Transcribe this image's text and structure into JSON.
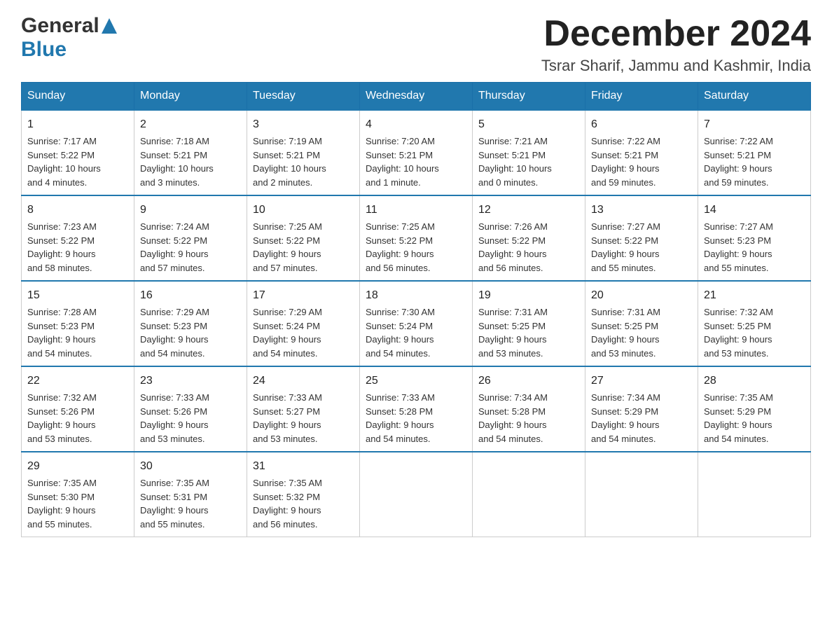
{
  "header": {
    "logo_general": "General",
    "logo_blue": "Blue",
    "month_title": "December 2024",
    "location": "Tsrar Sharif, Jammu and Kashmir, India"
  },
  "calendar": {
    "days_of_week": [
      "Sunday",
      "Monday",
      "Tuesday",
      "Wednesday",
      "Thursday",
      "Friday",
      "Saturday"
    ],
    "weeks": [
      [
        {
          "day": "1",
          "sunrise": "7:17 AM",
          "sunset": "5:22 PM",
          "daylight": "10 hours and 4 minutes."
        },
        {
          "day": "2",
          "sunrise": "7:18 AM",
          "sunset": "5:21 PM",
          "daylight": "10 hours and 3 minutes."
        },
        {
          "day": "3",
          "sunrise": "7:19 AM",
          "sunset": "5:21 PM",
          "daylight": "10 hours and 2 minutes."
        },
        {
          "day": "4",
          "sunrise": "7:20 AM",
          "sunset": "5:21 PM",
          "daylight": "10 hours and 1 minute."
        },
        {
          "day": "5",
          "sunrise": "7:21 AM",
          "sunset": "5:21 PM",
          "daylight": "10 hours and 0 minutes."
        },
        {
          "day": "6",
          "sunrise": "7:22 AM",
          "sunset": "5:21 PM",
          "daylight": "9 hours and 59 minutes."
        },
        {
          "day": "7",
          "sunrise": "7:22 AM",
          "sunset": "5:21 PM",
          "daylight": "9 hours and 59 minutes."
        }
      ],
      [
        {
          "day": "8",
          "sunrise": "7:23 AM",
          "sunset": "5:22 PM",
          "daylight": "9 hours and 58 minutes."
        },
        {
          "day": "9",
          "sunrise": "7:24 AM",
          "sunset": "5:22 PM",
          "daylight": "9 hours and 57 minutes."
        },
        {
          "day": "10",
          "sunrise": "7:25 AM",
          "sunset": "5:22 PM",
          "daylight": "9 hours and 57 minutes."
        },
        {
          "day": "11",
          "sunrise": "7:25 AM",
          "sunset": "5:22 PM",
          "daylight": "9 hours and 56 minutes."
        },
        {
          "day": "12",
          "sunrise": "7:26 AM",
          "sunset": "5:22 PM",
          "daylight": "9 hours and 56 minutes."
        },
        {
          "day": "13",
          "sunrise": "7:27 AM",
          "sunset": "5:22 PM",
          "daylight": "9 hours and 55 minutes."
        },
        {
          "day": "14",
          "sunrise": "7:27 AM",
          "sunset": "5:23 PM",
          "daylight": "9 hours and 55 minutes."
        }
      ],
      [
        {
          "day": "15",
          "sunrise": "7:28 AM",
          "sunset": "5:23 PM",
          "daylight": "9 hours and 54 minutes."
        },
        {
          "day": "16",
          "sunrise": "7:29 AM",
          "sunset": "5:23 PM",
          "daylight": "9 hours and 54 minutes."
        },
        {
          "day": "17",
          "sunrise": "7:29 AM",
          "sunset": "5:24 PM",
          "daylight": "9 hours and 54 minutes."
        },
        {
          "day": "18",
          "sunrise": "7:30 AM",
          "sunset": "5:24 PM",
          "daylight": "9 hours and 54 minutes."
        },
        {
          "day": "19",
          "sunrise": "7:31 AM",
          "sunset": "5:25 PM",
          "daylight": "9 hours and 53 minutes."
        },
        {
          "day": "20",
          "sunrise": "7:31 AM",
          "sunset": "5:25 PM",
          "daylight": "9 hours and 53 minutes."
        },
        {
          "day": "21",
          "sunrise": "7:32 AM",
          "sunset": "5:25 PM",
          "daylight": "9 hours and 53 minutes."
        }
      ],
      [
        {
          "day": "22",
          "sunrise": "7:32 AM",
          "sunset": "5:26 PM",
          "daylight": "9 hours and 53 minutes."
        },
        {
          "day": "23",
          "sunrise": "7:33 AM",
          "sunset": "5:26 PM",
          "daylight": "9 hours and 53 minutes."
        },
        {
          "day": "24",
          "sunrise": "7:33 AM",
          "sunset": "5:27 PM",
          "daylight": "9 hours and 53 minutes."
        },
        {
          "day": "25",
          "sunrise": "7:33 AM",
          "sunset": "5:28 PM",
          "daylight": "9 hours and 54 minutes."
        },
        {
          "day": "26",
          "sunrise": "7:34 AM",
          "sunset": "5:28 PM",
          "daylight": "9 hours and 54 minutes."
        },
        {
          "day": "27",
          "sunrise": "7:34 AM",
          "sunset": "5:29 PM",
          "daylight": "9 hours and 54 minutes."
        },
        {
          "day": "28",
          "sunrise": "7:35 AM",
          "sunset": "5:29 PM",
          "daylight": "9 hours and 54 minutes."
        }
      ],
      [
        {
          "day": "29",
          "sunrise": "7:35 AM",
          "sunset": "5:30 PM",
          "daylight": "9 hours and 55 minutes."
        },
        {
          "day": "30",
          "sunrise": "7:35 AM",
          "sunset": "5:31 PM",
          "daylight": "9 hours and 55 minutes."
        },
        {
          "day": "31",
          "sunrise": "7:35 AM",
          "sunset": "5:32 PM",
          "daylight": "9 hours and 56 minutes."
        },
        null,
        null,
        null,
        null
      ]
    ]
  }
}
